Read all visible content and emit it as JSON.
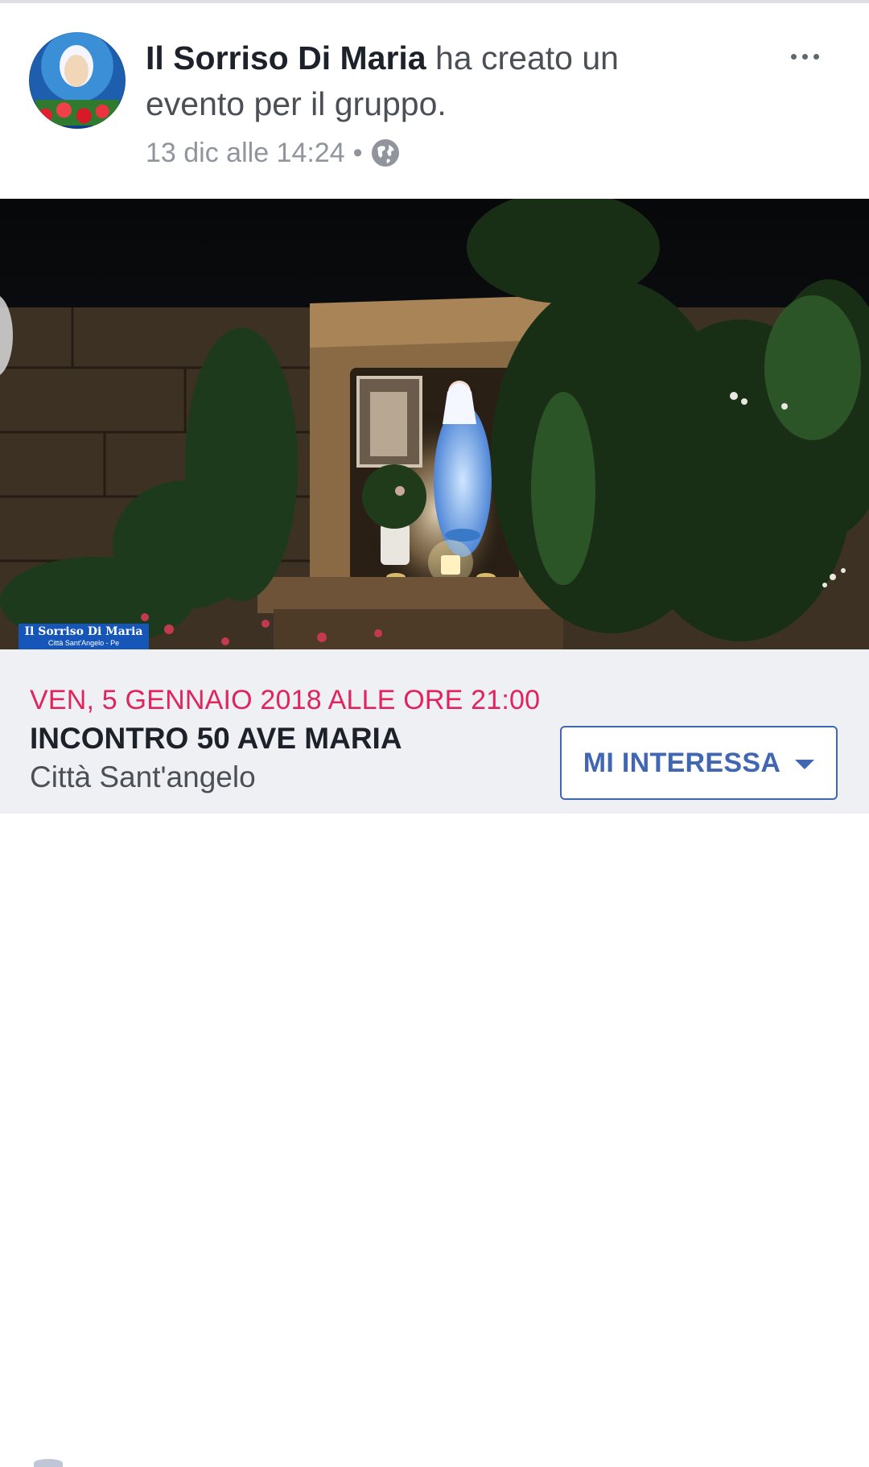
{
  "post": {
    "author": "Il Sorriso Di Maria",
    "action": " ha creato un evento per il gruppo.",
    "timestamp": "13 dic alle 14:24",
    "separator": "•",
    "privacy_icon": "globe-icon",
    "menu_icon": "more-options-icon"
  },
  "photo": {
    "watermark_title": "Il Sorriso Di Maria",
    "watermark_subtitle": "Città Sant'Angelo - Pe"
  },
  "event": {
    "date": "VEN, 5 GENNAIO 2018 ALLE ORE 21:00",
    "title": "INCONTRO 50 AVE MARIA",
    "location": "Città Sant'angelo",
    "button_label": "MI INTERESSA",
    "button_icon": "caret-down-icon"
  },
  "colors": {
    "date_red": "#e0245e",
    "button_blue": "#4267b2",
    "info_background": "#eef0f4"
  }
}
